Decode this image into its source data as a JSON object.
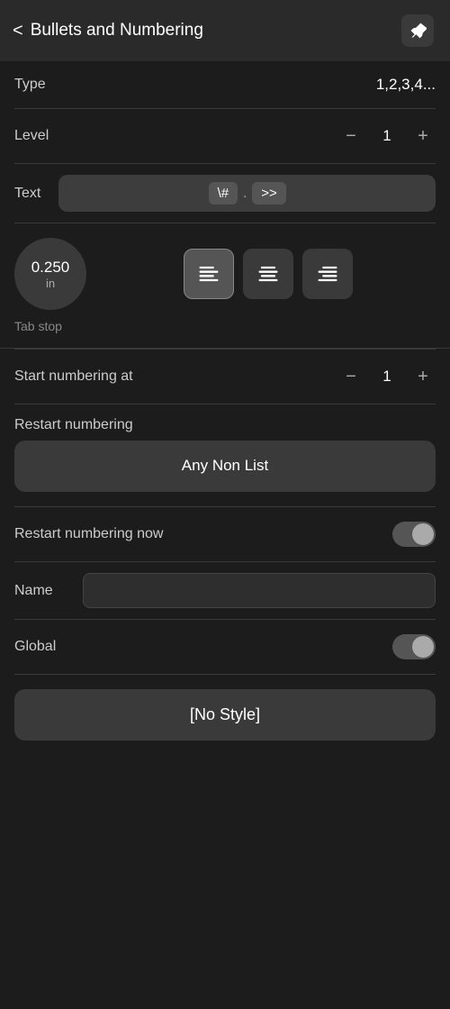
{
  "header": {
    "title": "Bullets and Numbering",
    "back_label": "<",
    "pin_icon": "📌"
  },
  "type_row": {
    "label": "Type",
    "value": "1,2,3,4..."
  },
  "level_row": {
    "label": "Level",
    "value": "1",
    "minus_label": "−",
    "plus_label": "+"
  },
  "text_row": {
    "label": "Text",
    "token1": "\\#",
    "dot": ".",
    "token2": ">>"
  },
  "tabstop": {
    "value": "0.250",
    "unit": "in",
    "label": "Tab stop",
    "alignments": [
      "left",
      "center",
      "right"
    ]
  },
  "start_numbering": {
    "label": "Start numbering at",
    "value": "1",
    "minus_label": "−",
    "plus_label": "+"
  },
  "restart_numbering": {
    "label": "Restart numbering",
    "button_label": "Any Non List"
  },
  "restart_now": {
    "label": "Restart numbering now"
  },
  "name_row": {
    "label": "Name",
    "placeholder": ""
  },
  "global_row": {
    "label": "Global"
  },
  "no_style": {
    "label": "[No Style]"
  }
}
